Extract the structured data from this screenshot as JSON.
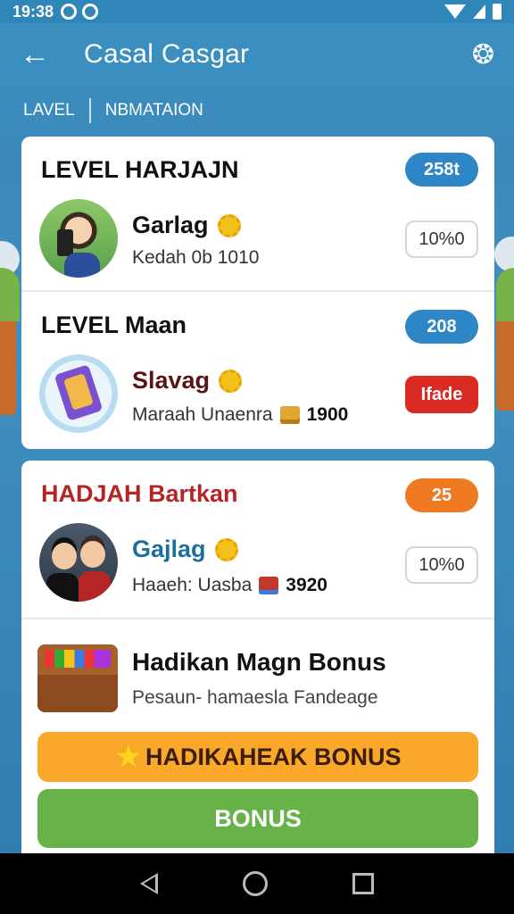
{
  "status_bar": {
    "time": "19:38"
  },
  "app_bar": {
    "title": "Casal Casgar"
  },
  "filters": {
    "left": "LAVEL",
    "right": "NBMATAION"
  },
  "level_sections": [
    {
      "title": "LEVEL HARJAJN",
      "badge": "258t",
      "user_name": "Garlag",
      "subtext": "Kedah 0b 1010",
      "action": "10%0"
    },
    {
      "title": "LEVEL Maan",
      "badge": "208",
      "user_name": "Slavag",
      "subtext": "Maraah Unaenra",
      "subtext_value": "1900",
      "action": "Ifade"
    },
    {
      "title": "HADJAH Bartkan",
      "badge": "25",
      "user_name": "Gajlag",
      "subtext": "Haaeh: Uasba",
      "subtext_value": "3920",
      "action": "10%0"
    }
  ],
  "bonus": {
    "title": "Hadikan Magn Bonus",
    "subtitle": "Pesaun- hamaesla Fandeage",
    "primary_button": "HADIKAHEAK BONUS",
    "secondary_button": "BONUS"
  },
  "colors": {
    "accent": "#2e86c6",
    "orange": "#f07a22",
    "red": "#d92b22",
    "green": "#67b34a",
    "yellow": "#f9a82a"
  }
}
